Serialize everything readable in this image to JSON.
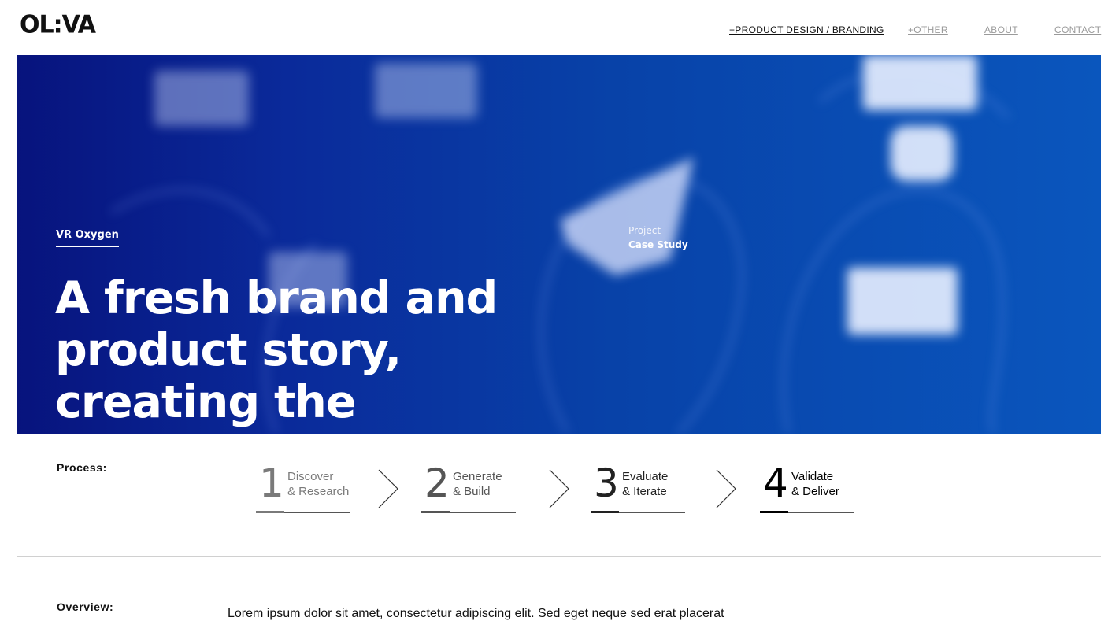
{
  "header": {
    "logo": "OL:VA",
    "nav": [
      "+PRODUCT DESIGN / BRANDING",
      "+OTHER",
      "ABOUT",
      "CONTACT"
    ]
  },
  "hero": {
    "tag": "VR Oxygen",
    "headline": "A fresh brand and product story, creating the market",
    "project_label": "Project",
    "project_type": "Case Study"
  },
  "process": {
    "label": "Process:",
    "steps": [
      {
        "num": "1",
        "line1": "Discover",
        "line2": "& Research"
      },
      {
        "num": "2",
        "line1": "Generate",
        "line2": "& Build"
      },
      {
        "num": "3",
        "line1": "Evaluate",
        "line2": "& Iterate"
      },
      {
        "num": "4",
        "line1": "Validate",
        "line2": "& Deliver"
      }
    ]
  },
  "overview": {
    "label": "Overview:",
    "text": "Lorem ipsum dolor sit amet, consectetur adipiscing elit. Sed eget neque sed erat placerat"
  },
  "colors": {
    "hero_start": "#07137d",
    "hero_end": "#0a56bd",
    "nav_active": "#111111",
    "nav_inactive": "#9a9a9a"
  }
}
